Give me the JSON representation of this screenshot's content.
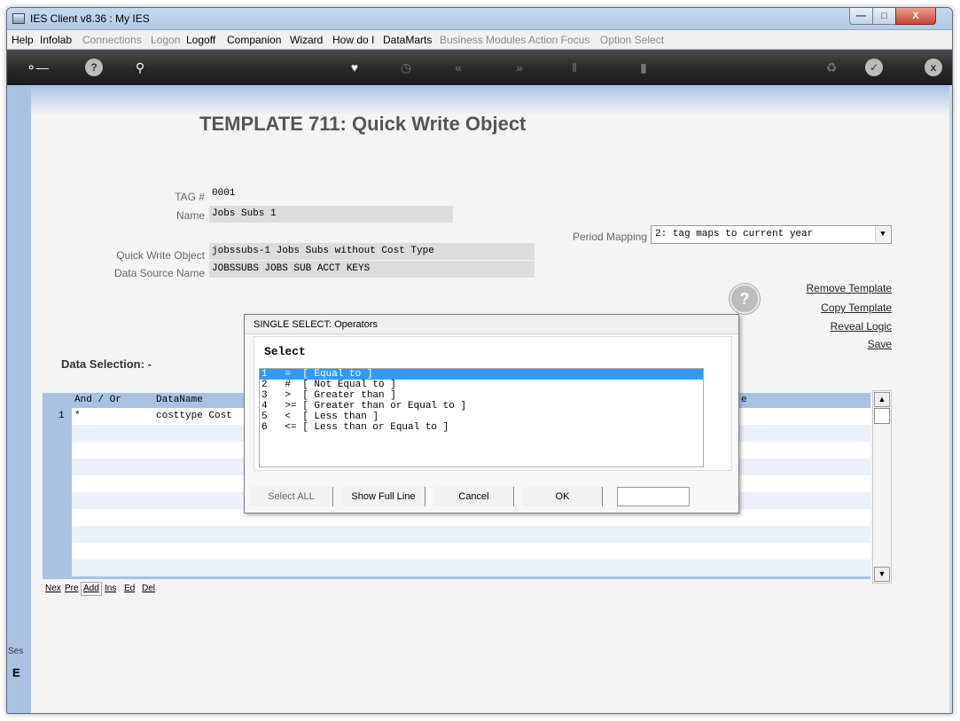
{
  "window": {
    "title": "IES Client v8.36 : My IES"
  },
  "menubar": {
    "items": [
      {
        "label": "Help",
        "enabled": true
      },
      {
        "label": "Infolab",
        "enabled": true
      },
      {
        "label": "Connections",
        "enabled": false
      },
      {
        "label": "Logon",
        "enabled": false
      },
      {
        "label": "Logoff",
        "enabled": true
      },
      {
        "label": "Companion",
        "enabled": true
      },
      {
        "label": "Wizard",
        "enabled": true
      },
      {
        "label": "How do I",
        "enabled": true
      },
      {
        "label": "DataMarts",
        "enabled": true
      },
      {
        "label": "Business Modules",
        "enabled": false
      },
      {
        "label": "Action Focus",
        "enabled": false
      },
      {
        "label": "Option Select",
        "enabled": false
      }
    ]
  },
  "toolbar": {
    "icons": [
      "key-icon",
      "help-icon",
      "search-icon",
      "heart-icon",
      "clock-icon",
      "back-icon",
      "forward-icon",
      "tools-icon",
      "window-icon",
      "recycle-icon",
      "check-icon",
      "close-icon"
    ]
  },
  "page": {
    "title": "TEMPLATE 711: Quick Write Object"
  },
  "form": {
    "tag_label": "TAG #",
    "tag_value": "0001",
    "name_label": "Name",
    "name_value": "Jobs Subs 1",
    "qwo_label": "Quick Write Object",
    "qwo_value": "jobssubs-1 Jobs Subs without Cost Type",
    "ds_label": "Data Source Name",
    "ds_value": "JOBSSUBS JOBS SUB ACCT KEYS",
    "period_label": "Period Mapping",
    "period_value": "2: tag maps to current year"
  },
  "links": {
    "remove": "Remove Template",
    "copy": "Copy Template",
    "reveal": "Reveal Logic",
    "save": "Save"
  },
  "data_selection": {
    "label": "Data Selection: -",
    "columns": {
      "and_or": "And / Or",
      "dataname": "DataName",
      "last": "e"
    },
    "rows": [
      {
        "num": "1",
        "and_or": "*",
        "dataname": "costtype Cost"
      }
    ]
  },
  "nav": {
    "buttons": [
      "Nex",
      "Pre",
      "Add",
      "Ins",
      "Ed",
      "Del"
    ]
  },
  "side": {
    "ses": "Ses",
    "e": "E"
  },
  "modal": {
    "title": "SINGLE SELECT: Operators",
    "heading": "Select",
    "options": [
      "1   =  [ Equal to ]",
      "2   #  [ Not Equal to ]",
      "3   >  [ Greater than ]",
      "4   >= [ Greater than or Equal to ]",
      "5   <  [ Less than ]",
      "6   <= [ Less than or Equal to ]"
    ],
    "selected_index": 0,
    "buttons": {
      "select_all": "Select ALL",
      "show_full_line": "Show Full Line",
      "cancel": "Cancel",
      "ok": "OK"
    },
    "input_value": ""
  }
}
